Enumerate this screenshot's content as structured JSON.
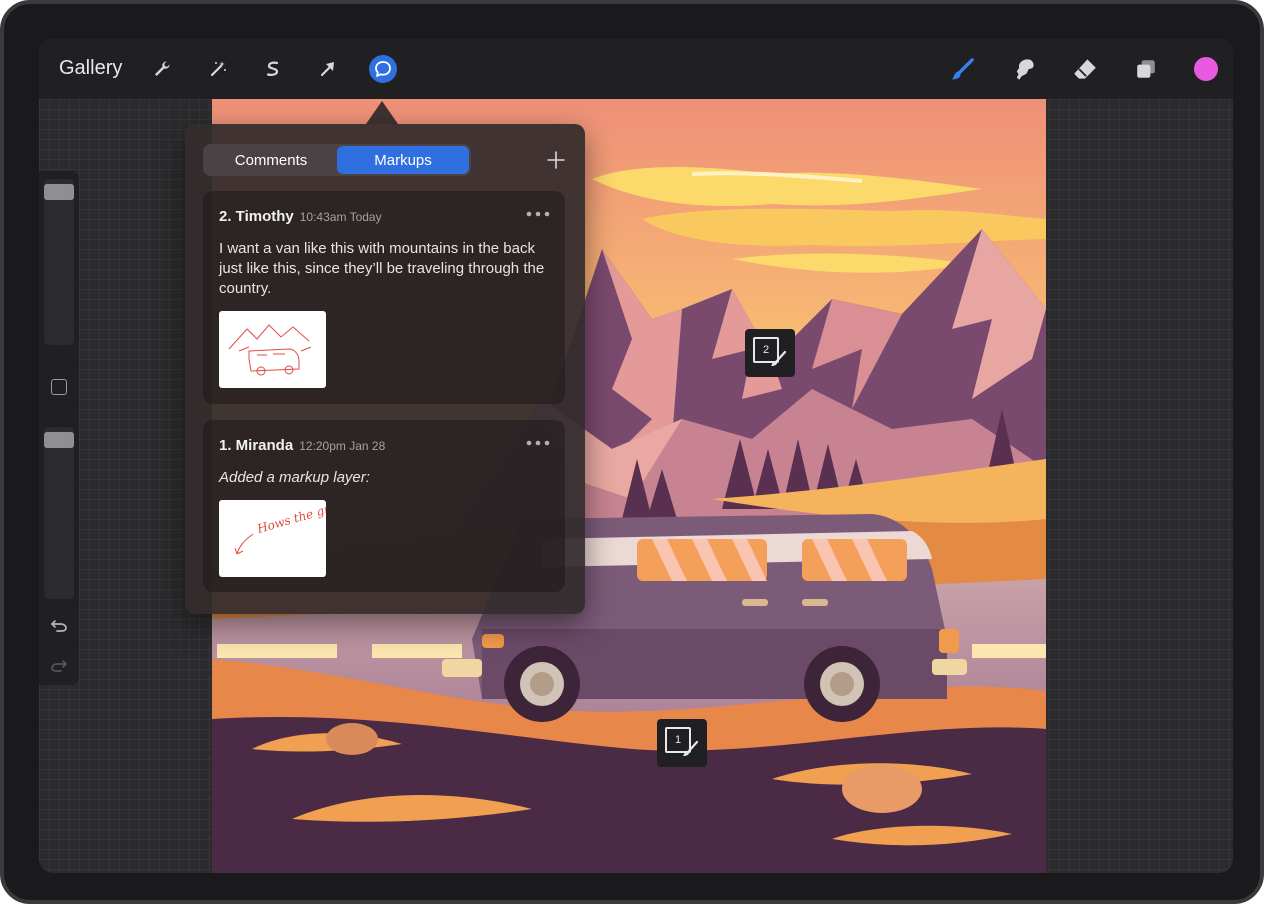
{
  "toolbar": {
    "gallery_label": "Gallery",
    "left_tools": [
      "wrench-icon",
      "magic-wand-icon",
      "selection-icon",
      "transform-arrow-icon",
      "comment-icon"
    ],
    "right_tools": [
      "brush-icon",
      "smudge-icon",
      "eraser-icon",
      "layers-icon"
    ],
    "active_tool": "comment-icon",
    "current_color": "#e85be0"
  },
  "sidebar": {
    "brush_size": 0.03,
    "opacity": 0.03
  },
  "popover": {
    "tabs": [
      {
        "label": "Comments",
        "active": false
      },
      {
        "label": "Markups",
        "active": true
      }
    ],
    "comments": [
      {
        "author": "2. Timothy",
        "time": "10:43am Today",
        "text": "I want a van like this with mountains in the back just like this, since they’ll be traveling through the country."
      },
      {
        "author": "1. Miranda",
        "time": "12:20pm Jan 28",
        "text": "Added a markup layer:",
        "sketch_text": "Hows the grass!"
      }
    ]
  },
  "markers": [
    {
      "number": "2"
    },
    {
      "number": "1"
    }
  ],
  "colors": {
    "accent": "#2f6fe0",
    "sky": "#f1957a",
    "mountain": "#7a4a6e"
  }
}
